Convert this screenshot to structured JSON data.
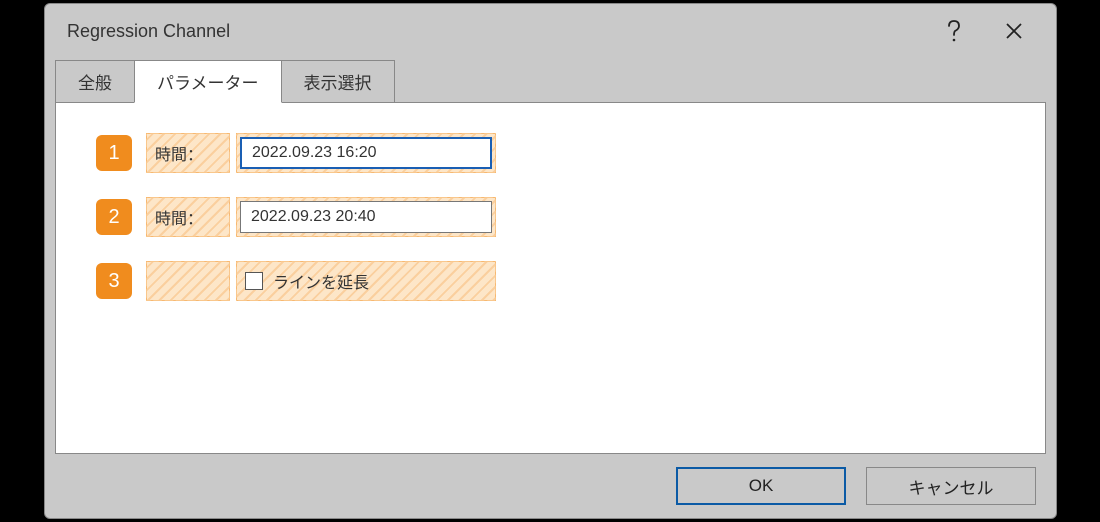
{
  "dialog": {
    "title": "Regression Channel"
  },
  "tabs": {
    "general": "全般",
    "parameters": "パラメーター",
    "display": "表示選択"
  },
  "rows": {
    "r1": {
      "badge": "1",
      "label": "時間：",
      "value": "2022.09.23 16:20"
    },
    "r2": {
      "badge": "2",
      "label": "時間：",
      "value": "2022.09.23 20:40"
    },
    "r3": {
      "badge": "3",
      "checkbox_label": "ラインを延長"
    }
  },
  "buttons": {
    "ok": "OK",
    "cancel": "キャンセル"
  }
}
